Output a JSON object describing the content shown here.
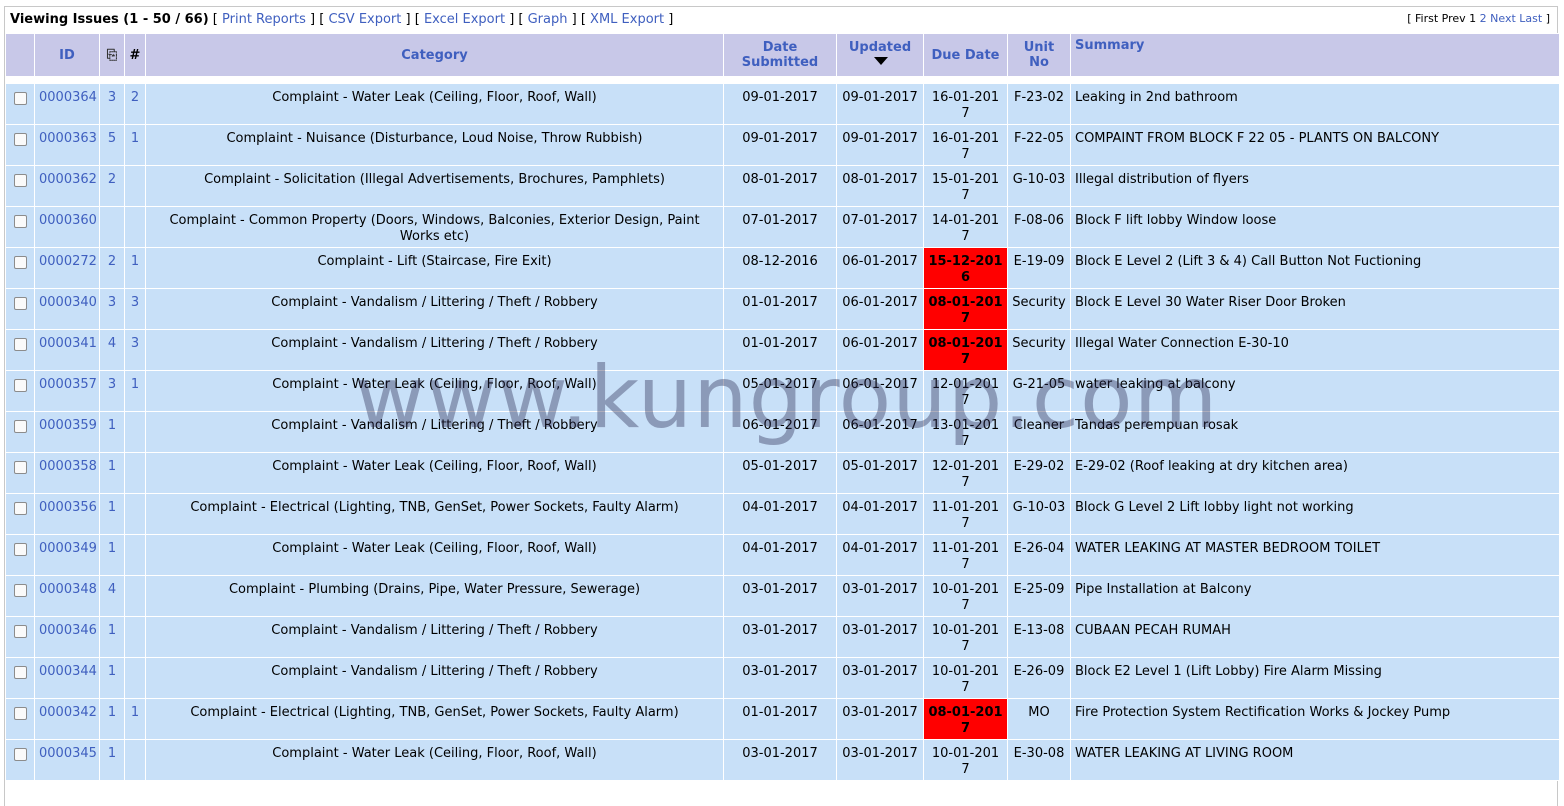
{
  "header": {
    "title": "Viewing Issues (1 - 50 / 66)",
    "links": [
      "Print Reports",
      "CSV Export",
      "Excel Export",
      "Graph",
      "XML Export"
    ]
  },
  "pager": {
    "first": "First",
    "prev": "Prev",
    "current": "1",
    "page2": "2",
    "next": "Next",
    "last": "Last"
  },
  "columns": {
    "id": "ID",
    "attachments_icon": "paperclip-icon",
    "notes": "#",
    "category": "Category",
    "date_submitted": "Date Submitted",
    "updated": "Updated",
    "due_date": "Due Date",
    "unit_no": "Unit No",
    "summary": "Summary"
  },
  "watermark": "www.kungroup.com",
  "colors": {
    "header_bg": "#c8c8e8",
    "row_bg": "#c8e0f8",
    "link": "#3f5fbf",
    "overdue": "#ff0000"
  },
  "rows": [
    {
      "id": "0000364",
      "att": "3",
      "notes": "2",
      "category": "Complaint - Water Leak (Ceiling, Floor, Roof, Wall)",
      "submitted": "09-01-2017",
      "updated": "09-01-2017",
      "due": "16-01-2017",
      "overdue": false,
      "unit": "F-23-02",
      "summary": "Leaking in 2nd bathroom"
    },
    {
      "id": "0000363",
      "att": "5",
      "notes": "1",
      "category": "Complaint - Nuisance (Disturbance, Loud Noise, Throw Rubbish)",
      "submitted": "09-01-2017",
      "updated": "09-01-2017",
      "due": "16-01-2017",
      "overdue": false,
      "unit": "F-22-05",
      "summary": "COMPAINT FROM BLOCK F 22 05 - PLANTS ON BALCONY"
    },
    {
      "id": "0000362",
      "att": "2",
      "notes": "",
      "category": "Complaint - Solicitation (Illegal Advertisements, Brochures, Pamphlets)",
      "submitted": "08-01-2017",
      "updated": "08-01-2017",
      "due": "15-01-2017",
      "overdue": false,
      "unit": "G-10-03",
      "summary": "Illegal distribution of flyers"
    },
    {
      "id": "0000360",
      "att": "",
      "notes": "",
      "category": "Complaint - Common Property (Doors, Windows, Balconies, Exterior Design, Paint Works etc)",
      "submitted": "07-01-2017",
      "updated": "07-01-2017",
      "due": "14-01-2017",
      "overdue": false,
      "unit": "F-08-06",
      "summary": "Block F lift lobby Window loose"
    },
    {
      "id": "0000272",
      "att": "2",
      "notes": "1",
      "category": "Complaint - Lift (Staircase, Fire Exit)",
      "submitted": "08-12-2016",
      "updated": "06-01-2017",
      "due": "15-12-2016",
      "overdue": true,
      "unit": "E-19-09",
      "summary": "Block E Level 2 (Lift 3 & 4) Call Button Not Fuctioning"
    },
    {
      "id": "0000340",
      "att": "3",
      "notes": "3",
      "category": "Complaint - Vandalism / Littering / Theft / Robbery",
      "submitted": "01-01-2017",
      "updated": "06-01-2017",
      "due": "08-01-2017",
      "overdue": true,
      "unit": "Security",
      "summary": "Block E Level 30 Water Riser Door Broken"
    },
    {
      "id": "0000341",
      "att": "4",
      "notes": "3",
      "category": "Complaint - Vandalism / Littering / Theft / Robbery",
      "submitted": "01-01-2017",
      "updated": "06-01-2017",
      "due": "08-01-2017",
      "overdue": true,
      "unit": "Security",
      "summary": "Illegal Water Connection E-30-10"
    },
    {
      "id": "0000357",
      "att": "3",
      "notes": "1",
      "category": "Complaint - Water Leak (Ceiling, Floor, Roof, Wall)",
      "submitted": "05-01-2017",
      "updated": "06-01-2017",
      "due": "12-01-2017",
      "overdue": false,
      "unit": "G-21-05",
      "summary": "water leaking at balcony"
    },
    {
      "id": "0000359",
      "att": "1",
      "notes": "",
      "category": "Complaint - Vandalism / Littering / Theft / Robbery",
      "submitted": "06-01-2017",
      "updated": "06-01-2017",
      "due": "13-01-2017",
      "overdue": false,
      "unit": "Cleaner",
      "summary": "Tandas perempuan rosak"
    },
    {
      "id": "0000358",
      "att": "1",
      "notes": "",
      "category": "Complaint - Water Leak (Ceiling, Floor, Roof, Wall)",
      "submitted": "05-01-2017",
      "updated": "05-01-2017",
      "due": "12-01-2017",
      "overdue": false,
      "unit": "E-29-02",
      "summary": "E-29-02 (Roof leaking at dry kitchen area)"
    },
    {
      "id": "0000356",
      "att": "1",
      "notes": "",
      "category": "Complaint - Electrical (Lighting, TNB, GenSet, Power Sockets, Faulty Alarm)",
      "submitted": "04-01-2017",
      "updated": "04-01-2017",
      "due": "11-01-2017",
      "overdue": false,
      "unit": "G-10-03",
      "summary": "Block G Level 2 Lift lobby light not working"
    },
    {
      "id": "0000349",
      "att": "1",
      "notes": "",
      "category": "Complaint - Water Leak (Ceiling, Floor, Roof, Wall)",
      "submitted": "04-01-2017",
      "updated": "04-01-2017",
      "due": "11-01-2017",
      "overdue": false,
      "unit": "E-26-04",
      "summary": "WATER LEAKING AT MASTER BEDROOM TOILET"
    },
    {
      "id": "0000348",
      "att": "4",
      "notes": "",
      "category": "Complaint - Plumbing (Drains, Pipe, Water Pressure, Sewerage)",
      "submitted": "03-01-2017",
      "updated": "03-01-2017",
      "due": "10-01-2017",
      "overdue": false,
      "unit": "E-25-09",
      "summary": "Pipe Installation at Balcony"
    },
    {
      "id": "0000346",
      "att": "1",
      "notes": "",
      "category": "Complaint - Vandalism / Littering / Theft / Robbery",
      "submitted": "03-01-2017",
      "updated": "03-01-2017",
      "due": "10-01-2017",
      "overdue": false,
      "unit": "E-13-08",
      "summary": "CUBAAN PECAH RUMAH"
    },
    {
      "id": "0000344",
      "att": "1",
      "notes": "",
      "category": "Complaint - Vandalism / Littering / Theft / Robbery",
      "submitted": "03-01-2017",
      "updated": "03-01-2017",
      "due": "10-01-2017",
      "overdue": false,
      "unit": "E-26-09",
      "summary": "Block E2 Level 1 (Lift Lobby) Fire Alarm Missing"
    },
    {
      "id": "0000342",
      "att": "1",
      "notes": "1",
      "category": "Complaint - Electrical (Lighting, TNB, GenSet, Power Sockets, Faulty Alarm)",
      "submitted": "01-01-2017",
      "updated": "03-01-2017",
      "due": "08-01-2017",
      "overdue": true,
      "unit": "MO",
      "summary": "Fire Protection System Rectification Works & Jockey Pump"
    },
    {
      "id": "0000345",
      "att": "1",
      "notes": "",
      "category": "Complaint - Water Leak (Ceiling, Floor, Roof, Wall)",
      "submitted": "03-01-2017",
      "updated": "03-01-2017",
      "due": "10-01-2017",
      "overdue": false,
      "unit": "E-30-08",
      "summary": "WATER LEAKING AT LIVING ROOM"
    }
  ]
}
